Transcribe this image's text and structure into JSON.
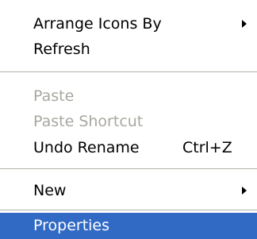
{
  "menu": {
    "arrange_icons_by": "Arrange Icons By",
    "refresh": "Refresh",
    "paste": "Paste",
    "paste_shortcut": "Paste Shortcut",
    "undo_rename": "Undo Rename",
    "undo_rename_shortcut": "Ctrl+Z",
    "new": "New",
    "properties": "Properties"
  },
  "submenu_arrow_icon": "triangle-right",
  "colors": {
    "highlight": "#316ac5",
    "disabled_text": "#a9a7a0",
    "separator": "#b2b1a9"
  }
}
